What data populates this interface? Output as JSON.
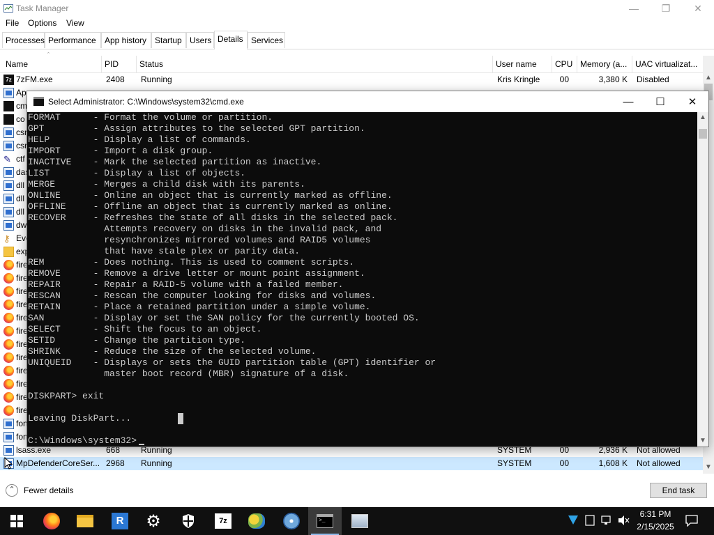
{
  "taskmanager": {
    "title": "Task Manager",
    "menu": [
      "File",
      "Options",
      "View"
    ],
    "tabs": [
      "Processes",
      "Performance",
      "App history",
      "Startup",
      "Users",
      "Details",
      "Services"
    ],
    "active_tab": "Details",
    "columns": {
      "name": "Name",
      "pid": "PID",
      "status": "Status",
      "username": "User name",
      "cpu": "CPU",
      "memory": "Memory (a...",
      "uac": "UAC virtualizat..."
    },
    "rows_top": [
      {
        "name": "7zFM.exe",
        "pid": "2408",
        "status": "Running",
        "username": "Kris Kringle",
        "cpu": "00",
        "memory": "3,380 K",
        "uac": "Disabled",
        "icon": "7zip-icon"
      },
      {
        "name": "Ap",
        "icon": "app-icon"
      },
      {
        "name": "cm",
        "icon": "cmd-icon"
      },
      {
        "name": "co",
        "icon": "cmd-icon"
      },
      {
        "name": "csr",
        "icon": "app-icon"
      },
      {
        "name": "csr",
        "icon": "app-icon"
      },
      {
        "name": "ctf",
        "icon": "pen-icon"
      },
      {
        "name": "das",
        "icon": "app-icon"
      },
      {
        "name": "dll",
        "icon": "app-icon"
      },
      {
        "name": "dll",
        "icon": "app-icon"
      },
      {
        "name": "dll",
        "icon": "app-icon"
      },
      {
        "name": "dw",
        "icon": "app-icon"
      },
      {
        "name": "Eve",
        "icon": "key-icon"
      },
      {
        "name": "exp",
        "icon": "folder-icon"
      },
      {
        "name": "fire",
        "icon": "firefox-icon"
      },
      {
        "name": "fire",
        "icon": "firefox-icon"
      },
      {
        "name": "fire",
        "icon": "firefox-icon"
      },
      {
        "name": "fire",
        "icon": "firefox-icon"
      },
      {
        "name": "fire",
        "icon": "firefox-icon"
      },
      {
        "name": "fire",
        "icon": "firefox-icon"
      },
      {
        "name": "fire",
        "icon": "firefox-icon"
      },
      {
        "name": "fire",
        "icon": "firefox-icon"
      },
      {
        "name": "fire",
        "icon": "firefox-icon"
      },
      {
        "name": "fire",
        "icon": "firefox-icon"
      },
      {
        "name": "fire",
        "icon": "firefox-icon"
      },
      {
        "name": "fire",
        "icon": "firefox-icon"
      },
      {
        "name": "fon",
        "icon": "app-icon"
      },
      {
        "name": "fon",
        "icon": "app-icon"
      }
    ],
    "rows_bottom": [
      {
        "name": "lsass.exe",
        "pid": "668",
        "status": "Running",
        "username": "SYSTEM",
        "cpu": "00",
        "memory": "2,936 K",
        "uac": "Not allowed",
        "icon": "app-icon"
      },
      {
        "name": "MpDefenderCoreSer...",
        "pid": "2968",
        "status": "Running",
        "username": "SYSTEM",
        "cpu": "00",
        "memory": "1,608 K",
        "uac": "Not allowed",
        "icon": "app-icon"
      }
    ],
    "fewer_details": "Fewer details",
    "end_task": "End task"
  },
  "cmd": {
    "title": "Select Administrator: C:\\Windows\\system32\\cmd.exe",
    "lines": [
      "FORMAT      - Format the volume or partition.",
      "GPT         - Assign attributes to the selected GPT partition.",
      "HELP        - Display a list of commands.",
      "IMPORT      - Import a disk group.",
      "INACTIVE    - Mark the selected partition as inactive.",
      "LIST        - Display a list of objects.",
      "MERGE       - Merges a child disk with its parents.",
      "ONLINE      - Online an object that is currently marked as offline.",
      "OFFLINE     - Offline an object that is currently marked as online.",
      "RECOVER     - Refreshes the state of all disks in the selected pack.",
      "              Attempts recovery on disks in the invalid pack, and",
      "              resynchronizes mirrored volumes and RAID5 volumes",
      "              that have stale plex or parity data.",
      "REM         - Does nothing. This is used to comment scripts.",
      "REMOVE      - Remove a drive letter or mount point assignment.",
      "REPAIR      - Repair a RAID-5 volume with a failed member.",
      "RESCAN      - Rescan the computer looking for disks and volumes.",
      "RETAIN      - Place a retained partition under a simple volume.",
      "SAN         - Display or set the SAN policy for the currently booted OS.",
      "SELECT      - Shift the focus to an object.",
      "SETID       - Change the partition type.",
      "SHRINK      - Reduce the size of the selected volume.",
      "UNIQUEID    - Displays or sets the GUID partition table (GPT) identifier or",
      "              master boot record (MBR) signature of a disk.",
      "",
      "DISKPART> exit",
      "",
      "Leaving DiskPart...",
      "",
      "C:\\Windows\\system32>"
    ]
  },
  "taskbar": {
    "apps": [
      "start-icon",
      "firefox-icon",
      "file-explorer-icon",
      "remote-desktop-icon",
      "settings-gear-icon",
      "windows-security-shield-icon",
      "7zip-icon",
      "paint-icon",
      "disc-icon",
      "cmd-icon",
      "control-panel-icon"
    ],
    "active_app": "cmd-icon",
    "time": "6:31 PM",
    "date": "2/15/2025"
  }
}
